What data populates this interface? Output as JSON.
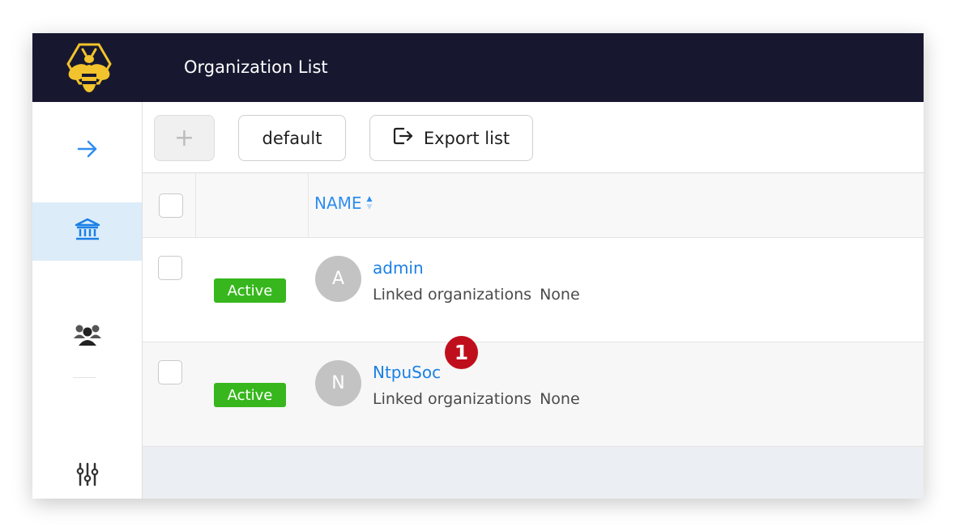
{
  "header": {
    "title": "Organization List",
    "logo_icon": "bee-logo-icon",
    "background": "#171830"
  },
  "sidebar": {
    "items": [
      {
        "icon": "arrow-right-icon",
        "active": false
      },
      {
        "icon": "bank-icon",
        "active": true
      },
      {
        "icon": "users-icon",
        "active": false
      },
      {
        "icon": "sliders-icon",
        "active": false
      }
    ]
  },
  "toolbar": {
    "add_label": "+",
    "default_label": "default",
    "export_label": "Export list",
    "export_icon": "export-icon"
  },
  "table": {
    "columns": {
      "name": "NAME"
    },
    "sort": "ascending",
    "rows": [
      {
        "status": "Active",
        "avatar": "A",
        "name": "admin",
        "linked_label": "Linked organizations",
        "linked_value": "None"
      },
      {
        "status": "Active",
        "avatar": "N",
        "name": "NtpuSoc",
        "linked_label": "Linked organizations",
        "linked_value": "None"
      }
    ]
  },
  "annotation": {
    "marker": "1"
  },
  "colors": {
    "accent": "#2f8df0",
    "status_active": "#37b71d",
    "marker": "#c00f1c",
    "active_nav": "#dcecf9"
  }
}
